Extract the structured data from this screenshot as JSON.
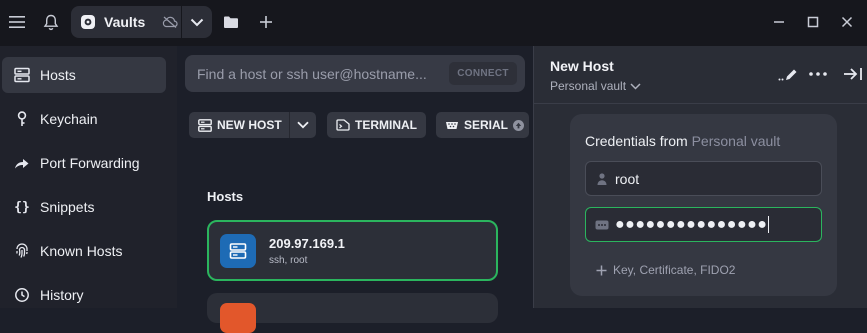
{
  "titlebar": {
    "vault_tab_label": "Vaults",
    "icons": [
      "menu-icon",
      "bell-icon",
      "vault-icon",
      "cloud-off-icon",
      "chevron-down-icon",
      "folder-icon",
      "plus-icon",
      "minimize-icon",
      "maximize-icon",
      "close-icon"
    ]
  },
  "sidebar": {
    "items": [
      {
        "label": "Hosts",
        "icon": "server-icon",
        "active": true
      },
      {
        "label": "Keychain",
        "icon": "key-icon"
      },
      {
        "label": "Port Forwarding",
        "icon": "arrow-forward-icon"
      },
      {
        "label": "Snippets",
        "icon": "braces-icon"
      },
      {
        "label": "Known Hosts",
        "icon": "fingerprint-icon"
      },
      {
        "label": "History",
        "icon": "clock-icon"
      }
    ]
  },
  "search": {
    "placeholder": "Find a host or ssh user@hostname...",
    "connect_label": "CONNECT"
  },
  "toolbar": {
    "new_host_label": "NEW HOST",
    "terminal_label": "TERMINAL",
    "serial_label": "SERIAL"
  },
  "hosts": {
    "heading": "Hosts",
    "items": [
      {
        "title": "209.97.169.1",
        "subtitle": "ssh, root",
        "color": "#1e6bb5"
      }
    ]
  },
  "panel": {
    "title": "New Host",
    "vault_label": "Personal vault",
    "credentials": {
      "label": "Credentials from",
      "vault": "Personal vault",
      "username": "root",
      "password": "●●●●●●●●●●●●●●●",
      "add_label": "Key, Certificate, FIDO2"
    }
  },
  "colors": {
    "accent_green": "#2bb55e",
    "host_icon_blue": "#1e6bb5",
    "host_icon_orange": "#e2572b"
  }
}
